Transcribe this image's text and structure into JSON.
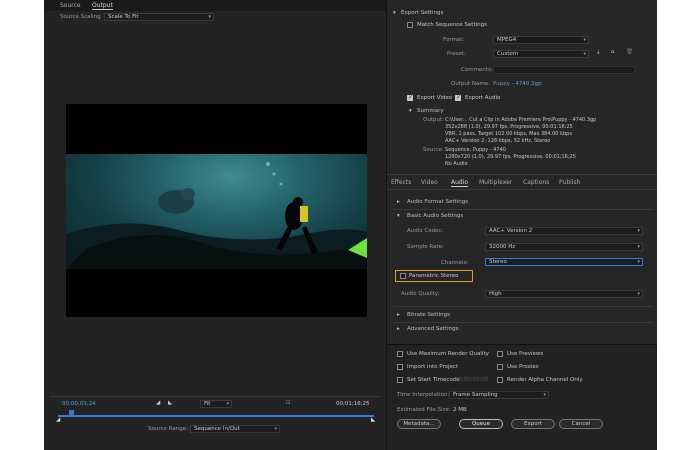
{
  "source_tabs": [
    "Source",
    "Output"
  ],
  "source_scaling": {
    "label": "Source Scaling",
    "value": "Scale To Fit"
  },
  "timeline": {
    "current_time": "00;00;03;24",
    "fit": "Fit",
    "duration": "00;01;16;25"
  },
  "source_range": {
    "label": "Source Range:",
    "value": "Sequence In/Out"
  },
  "export_settings": {
    "title": "Export Settings",
    "match_sequence": "Match Sequence Settings",
    "format_label": "Format:",
    "format_value": "MPEG4",
    "preset_label": "Preset:",
    "preset_value": "Custom",
    "comments_label": "Comments:",
    "output_name_label": "Output Name:",
    "output_name_value": "Puppy - 4740.3gp",
    "export_video": "Export Video",
    "export_audio": "Export Audio"
  },
  "summary": {
    "title": "Summary",
    "output_label": "Output:",
    "output_lines": [
      "C:\\User... Cut a Clip in Adobe Premiere Pro\\Puppy - 4740.3gp",
      "352x288 (1.0), 29.97 fps, Progressive, 00:01:16:25",
      "VBR, 1 pass, Target 102.00 kbps, Max 384.00 kbps",
      "AAC+ Version 2, 128 kbps, 32 kHz, Stereo"
    ],
    "source_label": "Source:",
    "source_lines": [
      "Sequence, Puppy - 4740",
      "1280x720 (1.0), 29.97 fps, Progressive, 00;01;16;25",
      "No Audio"
    ]
  },
  "settings_tabs": [
    "Effects",
    "Video",
    "Audio",
    "Multiplexer",
    "Captions",
    "Publish"
  ],
  "audio": {
    "format_settings": "Audio Format Settings",
    "basic_settings": "Basic Audio Settings",
    "codec_label": "Audio Codec:",
    "codec_value": "AAC+ Version 2",
    "sample_rate_label": "Sample Rate:",
    "sample_rate_value": "32000 Hz",
    "channels_label": "Channels:",
    "channels_value": "Stereo",
    "parametric_stereo": "Parametric Stereo",
    "quality_label": "Audio Quality:",
    "quality_value": "High",
    "bitrate_settings": "Bitrate Settings",
    "advanced_settings": "Advanced Settings"
  },
  "options": {
    "max_render": "Use Maximum Render Quality",
    "use_previews": "Use Previews",
    "import_project": "Import into Project",
    "use_proxies": "Use Proxies",
    "set_start_tc": "Set Start Timecode",
    "start_tc_value": "00;00;00;00",
    "render_alpha": "Render Alpha Channel Only",
    "time_interp_label": "Time Interpolation:",
    "time_interp_value": "Frame Sampling",
    "file_size_label": "Estimated File Size:",
    "file_size_value": "2 MB"
  },
  "buttons": {
    "metadata": "Metadata...",
    "queue": "Queue",
    "export": "Export",
    "cancel": "Cancel"
  },
  "colors": {
    "accent_blue": "#3a7bd5",
    "highlight_orange": "#e0a020"
  }
}
